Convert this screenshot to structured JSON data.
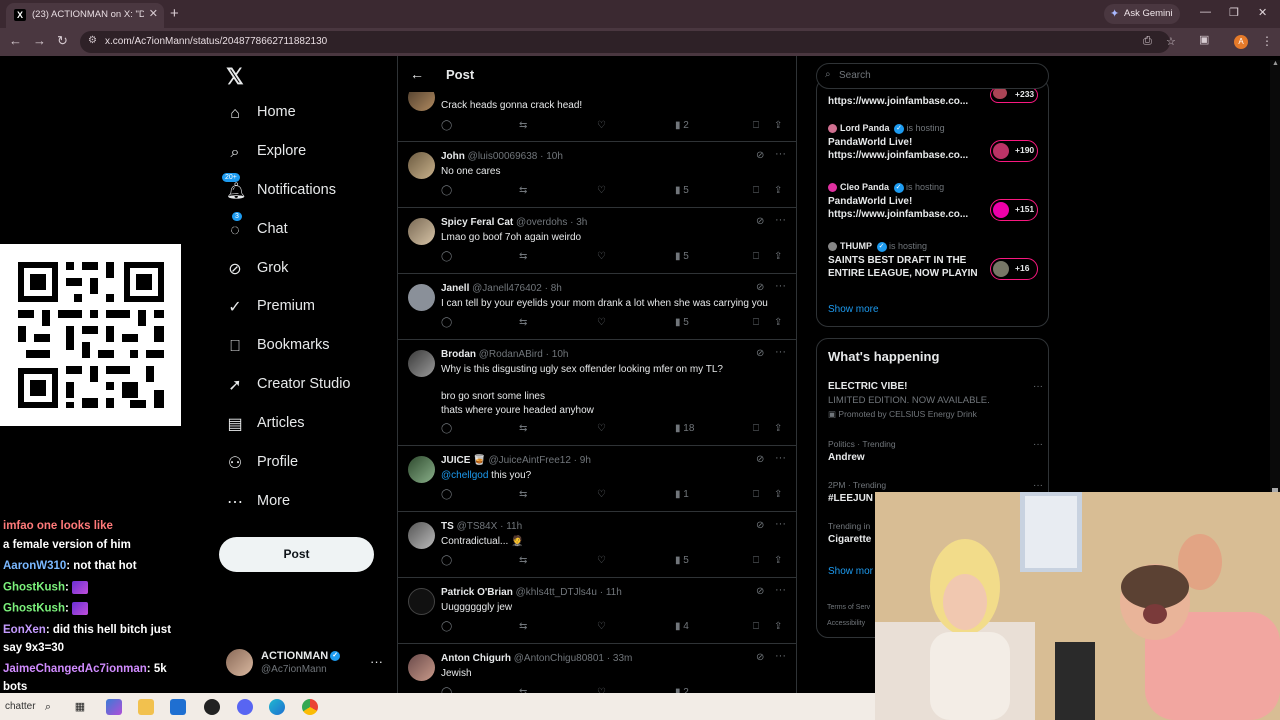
{
  "browser": {
    "tab_favicon": "X",
    "tab_title": "(23) ACTIONMAN on X: \"Dude",
    "url": "x.com/Ac7ionMann/status/2048778662711882130",
    "ask_gemini": "Ask Gemini",
    "profile_initial": "A"
  },
  "nav": {
    "logo": "𝕏",
    "items": [
      {
        "label": "Home",
        "icon": "home-icon"
      },
      {
        "label": "Explore",
        "icon": "search-icon"
      },
      {
        "label": "Notifications",
        "icon": "bell-icon",
        "badge": "20+"
      },
      {
        "label": "Chat",
        "icon": "chat-icon",
        "badge": "3"
      },
      {
        "label": "Grok",
        "icon": "grok-icon"
      },
      {
        "label": "Premium",
        "icon": "premium-icon"
      },
      {
        "label": "Bookmarks",
        "icon": "bookmark-icon"
      },
      {
        "label": "Creator Studio",
        "icon": "rocket-icon"
      },
      {
        "label": "Articles",
        "icon": "article-icon"
      },
      {
        "label": "Profile",
        "icon": "person-icon"
      },
      {
        "label": "More",
        "icon": "more-circle-icon"
      }
    ],
    "post_button": "Post",
    "account": {
      "name": "ACTIONMAN",
      "handle": "@Ac7ionMann"
    }
  },
  "main": {
    "title": "Post",
    "replies": [
      {
        "name": "",
        "handle": "",
        "time": "",
        "text": "Crack heads gonna crack head!",
        "views": "2"
      },
      {
        "name": "John",
        "handle": "@luis00069638",
        "time": "10h",
        "text": "No one cares",
        "views": "5"
      },
      {
        "name": "Spicy Feral Cat",
        "handle": "@overdohs",
        "time": "3h",
        "text": "Lmao go boof 7oh again weirdo",
        "views": "5"
      },
      {
        "name": "Janell",
        "handle": "@Janell476402",
        "time": "8h",
        "text": "I can tell by your eyelids your mom drank a lot when she was carrying you",
        "views": "5"
      },
      {
        "name": "Brodan",
        "handle": "@RodanABird",
        "time": "10h",
        "text": "Why is this disgusting ugly sex offender looking mfer on my TL?\n\nbro go snort some lines\nthats where youre headed anyhow",
        "views": "18"
      },
      {
        "name": "JUICE 🥃",
        "handle": "@JuiceAintFree12",
        "time": "9h",
        "mention": "@chellgod",
        "text": " this you?",
        "views": "1"
      },
      {
        "name": "TS",
        "handle": "@TS84X",
        "time": "11h",
        "text": "Contradictual... 🤵",
        "views": "5"
      },
      {
        "name": "Patrick O'Brian",
        "handle": "@khls4tt_DTJls4u",
        "time": "11h",
        "text": "Uuggggggly jew",
        "views": "4"
      },
      {
        "name": "Anton Chigurh",
        "handle": "@AntonChigu80801",
        "time": "33m",
        "text": "Jewish",
        "views": "2"
      }
    ]
  },
  "right": {
    "search_placeholder": "Search",
    "live": [
      {
        "host": "",
        "status": "",
        "title": "https://www.joinfambase.co...",
        "count": "+233"
      },
      {
        "host": "Lord Panda",
        "status": "is hosting",
        "title_line1": "PandaWorld Live!",
        "title": "https://www.joinfambase.co...",
        "count": "+190"
      },
      {
        "host": "Cleo Panda",
        "status": "is hosting",
        "title_line1": "PandaWorld Live!",
        "title": "https://www.joinfambase.co...",
        "count": "+151"
      },
      {
        "host": "THUMP",
        "status": "is hosting",
        "title_line1": "SAINTS BEST DRAFT IN THE",
        "title": "ENTIRE LEAGUE, NOW PLAYIN...",
        "count": "+16"
      }
    ],
    "show_more": "Show more",
    "whats_happening": "What's happening",
    "trends": [
      {
        "meta": "",
        "name": "ELECTRIC VIBE!",
        "sub": "LIMITED EDITION. NOW AVAILABLE.",
        "promo": "Promoted by CELSIUS Energy Drink"
      },
      {
        "meta": "Politics · Trending",
        "name": "Andrew"
      },
      {
        "meta": "2PM · Trending",
        "name": "#LEEJUN"
      },
      {
        "meta": "Trending in",
        "name": "Cigarette"
      }
    ],
    "show_more_2": "Show mor",
    "footer_1": "Terms of Serv",
    "footer_2": "Accessibility"
  },
  "chat": [
    {
      "user": "",
      "msg": "imfao one looks like",
      "color": "#ff7a7a"
    },
    {
      "user": "",
      "msg": "a female version of him",
      "color": "#ffffff"
    },
    {
      "user": "AaronW310",
      "msg": ": not that hot",
      "color": "#7ab8ff"
    },
    {
      "user": "GhostKush",
      "msg": ":",
      "emote": true,
      "color": "#7cf27c"
    },
    {
      "user": "GhostKush",
      "msg": ":",
      "emote": true,
      "color": "#7cf27c"
    },
    {
      "user": "EonXen",
      "msg": ": did this hell bitch just",
      "color": "#c59bff"
    },
    {
      "user": "",
      "msg": "say 9x3=30",
      "color": "#ffffff"
    },
    {
      "user": "JaimeChangedAc7ionman",
      "msg": ": 5k",
      "color": "#d18cff"
    },
    {
      "user": "",
      "msg": "bots",
      "color": "#ffffff"
    }
  ],
  "taskbar": {
    "search_text": "chatter"
  }
}
